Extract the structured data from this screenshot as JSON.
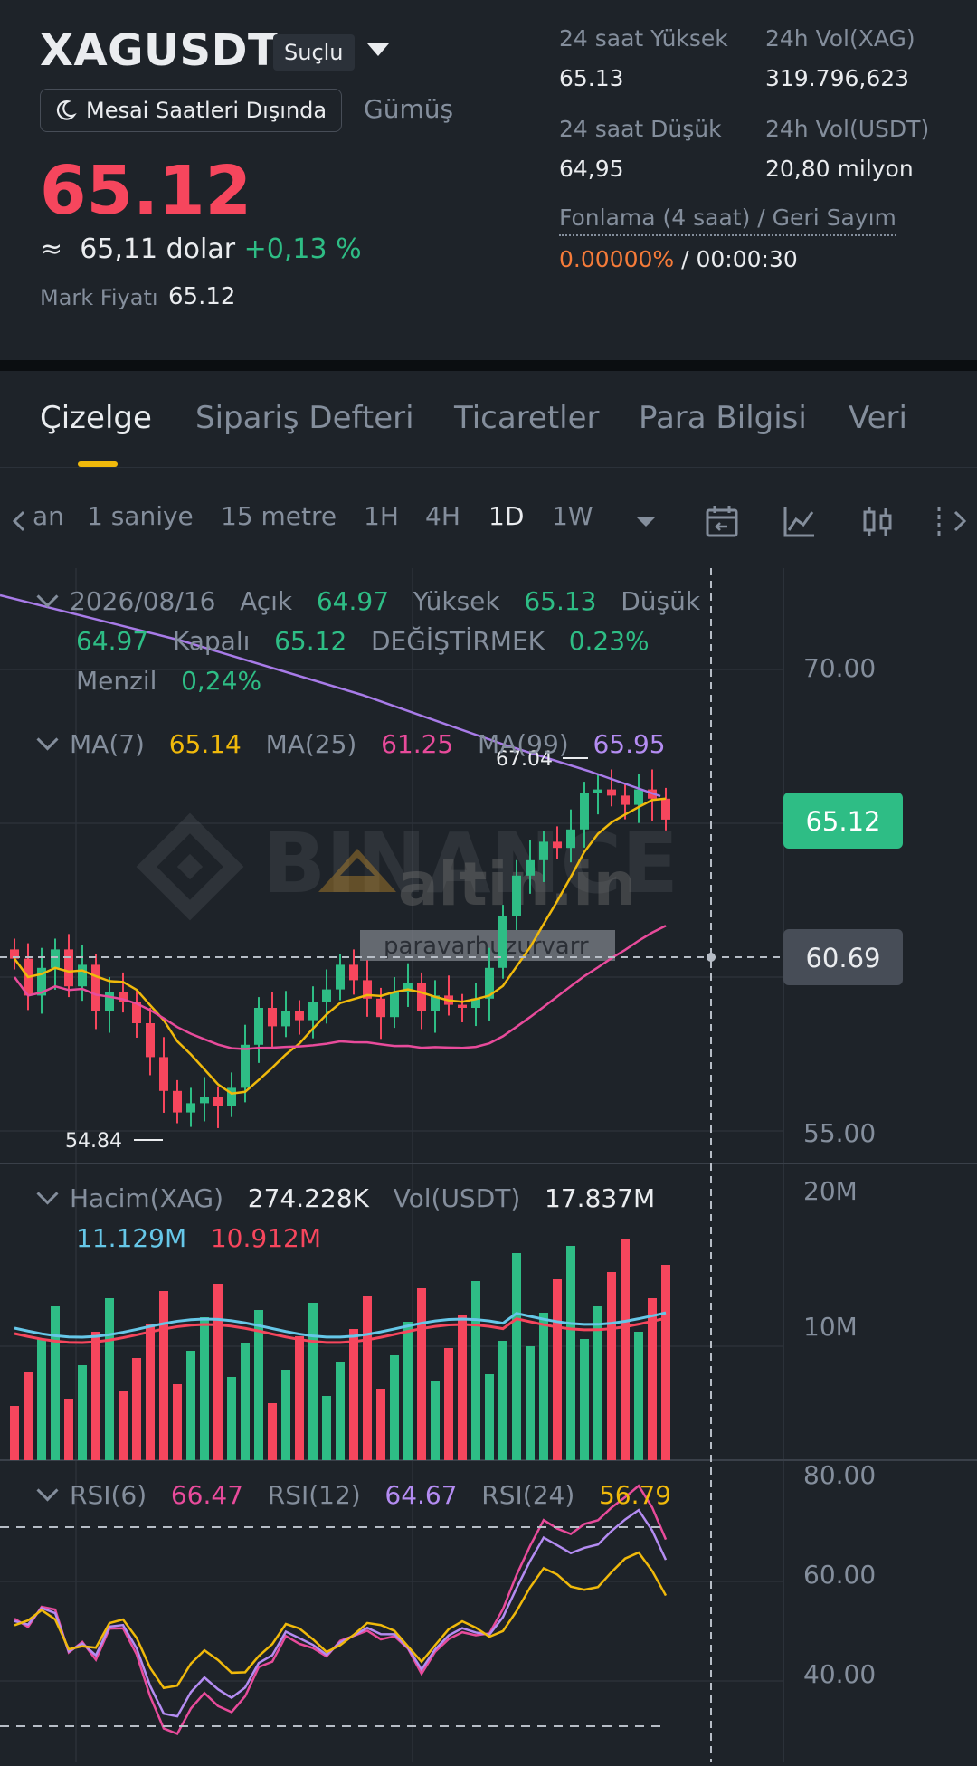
{
  "header": {
    "symbol": "XAGUSDT",
    "badge": "Suçlu",
    "session": "Mesai Saatleri Dışında",
    "asset_name": "Gümüş",
    "price": "65.12",
    "approx_symbol": "≈",
    "approx_usd": "65,11 dolar",
    "change_pct": "+0,13 %",
    "mark_label": "Mark Fiyatı",
    "mark_value": "65.12"
  },
  "stats": {
    "high_label": "24 saat Yüksek",
    "high_value": "65.13",
    "low_label": "24 saat Düşük",
    "low_value": "64,95",
    "vol_xag_label": "24h Vol(XAG)",
    "vol_xag_value": "319.796,623",
    "vol_usdt_label": "24h Vol(USDT)",
    "vol_usdt_value": "20,80 milyon",
    "funding_label": "Fonlama (4 saat) / Geri Sayım",
    "funding_rate": "0.00000%",
    "funding_sep": "/",
    "countdown": "00:00:30"
  },
  "tabs": [
    "Çizelge",
    "Sipariş Defteri",
    "Ticaretler",
    "Para Bilgisi",
    "Veri"
  ],
  "intervals": [
    "an",
    "1 saniye",
    "15 metre",
    "1H",
    "4H",
    "1D",
    "1W"
  ],
  "icons": [
    "chevron-left-icon",
    "dropdown-caret-icon",
    "calendar-icon",
    "indicator-icon",
    "candle-type-icon",
    "more-icon",
    "chevron-right-icon"
  ],
  "ohlc": {
    "date": "2026/08/16",
    "open_label": "Açık",
    "open": "64.97",
    "high_label": "Yüksek",
    "high": "65.13",
    "low_label": "Düşük",
    "low": "64.97",
    "close_label": "Kapalı",
    "close": "65.12",
    "change_label": "DEĞİŞTİRMEK",
    "change": "0.23%",
    "range_label": "Menzil",
    "range": "0,24%"
  },
  "ma": {
    "ma7_label": "MA(7)",
    "ma7": "65.14",
    "ma25_label": "MA(25)",
    "ma25": "61.25",
    "ma99_label": "MA(99)",
    "ma99": "65.95"
  },
  "volume": {
    "label": "Hacim(XAG)",
    "value": "274.228K",
    "usdt_label": "Vol(USDT)",
    "usdt_value": "17.837M",
    "ma1": "11.129M",
    "ma2": "10.912M"
  },
  "rsi": {
    "rsi6_label": "RSI(6)",
    "rsi6": "66.47",
    "rsi12_label": "RSI(12)",
    "rsi12": "64.67",
    "rsi24_label": "RSI(24)",
    "rsi24": "56.79"
  },
  "axis": {
    "price_ticks": [
      "70.00",
      "55.00"
    ],
    "current_price": "65.12",
    "crosshair_price": "60.69",
    "max_marker": "67.04",
    "min_marker": "54.84",
    "volume_ticks": [
      "20M",
      "10M"
    ],
    "rsi_ticks": [
      "80.00",
      "60.00",
      "40.00"
    ]
  },
  "watermark": {
    "brand": "BINANCE",
    "site": "altin.in",
    "user": "paravarhuzurvarr"
  },
  "colors": {
    "up": "#2ebd85",
    "down": "#f6465d",
    "ma7": "#f0b90b",
    "ma25": "#e84b9b",
    "ma99": "#a87be8",
    "accent": "#f0b90b",
    "funding": "#f57b39"
  }
}
